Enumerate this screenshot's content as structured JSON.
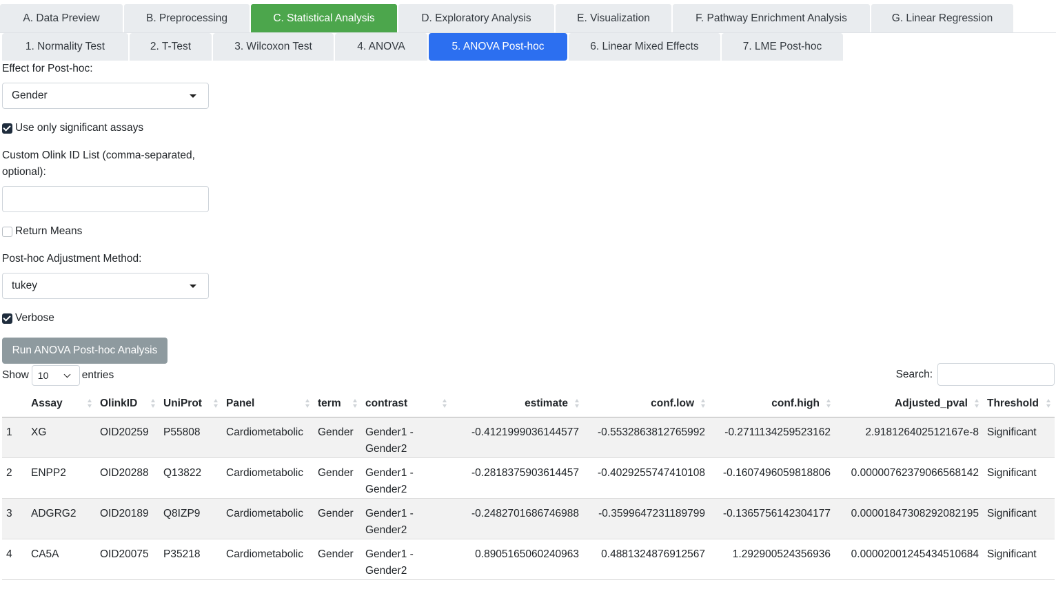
{
  "main_tabs": [
    {
      "label": "A. Data Preview"
    },
    {
      "label": "B. Preprocessing"
    },
    {
      "label": "C. Statistical Analysis"
    },
    {
      "label": "D. Exploratory Analysis"
    },
    {
      "label": "E. Visualization"
    },
    {
      "label": "F. Pathway Enrichment Analysis"
    },
    {
      "label": "G. Linear Regression"
    }
  ],
  "sub_tabs": [
    {
      "label": "1. Normality Test"
    },
    {
      "label": "2. T-Test"
    },
    {
      "label": "3. Wilcoxon Test"
    },
    {
      "label": "4. ANOVA"
    },
    {
      "label": "5. ANOVA Post-hoc"
    },
    {
      "label": "6. Linear Mixed Effects"
    },
    {
      "label": "7. LME Post-hoc"
    }
  ],
  "form": {
    "effect_label": "Effect for Post-hoc:",
    "effect_value": "Gender",
    "significant_label": "Use only significant assays",
    "significant_checked": true,
    "custom_label_1": "Custom Olink ID List (comma-separated,",
    "custom_label_2": "optional):",
    "custom_value": "",
    "return_means_label": "Return Means",
    "return_means_checked": false,
    "adjust_label": "Post-hoc Adjustment Method:",
    "adjust_value": "tukey",
    "verbose_label": "Verbose",
    "verbose_checked": true,
    "run_button": "Run ANOVA Post-hoc Analysis"
  },
  "table_controls": {
    "show_label": "Show",
    "entries_value": "10",
    "entries_label": "entries",
    "search_label": "Search:"
  },
  "table": {
    "headers": [
      "",
      "Assay",
      "OlinkID",
      "UniProt",
      "Panel",
      "term",
      "contrast",
      "estimate",
      "conf.low",
      "conf.high",
      "Adjusted_pval",
      "Threshold"
    ],
    "rows": [
      [
        "1",
        "XG",
        "OID20259",
        "P55808",
        "Cardiometabolic",
        "Gender",
        "Gender1 - Gender2",
        "-0.4121999036144577",
        "-0.5532863812765992",
        "-0.2711134259523162",
        "2.918126402512167e-8",
        "Significant"
      ],
      [
        "2",
        "ENPP2",
        "OID20288",
        "Q13822",
        "Cardiometabolic",
        "Gender",
        "Gender1 - Gender2",
        "-0.2818375903614457",
        "-0.4029255747410108",
        "-0.1607496059818806",
        "0.00000762379066568142",
        "Significant"
      ],
      [
        "3",
        "ADGRG2",
        "OID20189",
        "Q8IZP9",
        "Cardiometabolic",
        "Gender",
        "Gender1 - Gender2",
        "-0.2482701686746988",
        "-0.3599647231189799",
        "-0.1365756142304177",
        "0.00001847308292082195",
        "Significant"
      ],
      [
        "4",
        "CA5A",
        "OID20075",
        "P35218",
        "Cardiometabolic",
        "Gender",
        "Gender1 - Gender2",
        "0.8905165060240963",
        "0.4881324876912567",
        "1.292900524356936",
        "0.00002001245434510684",
        "Significant"
      ]
    ]
  }
}
